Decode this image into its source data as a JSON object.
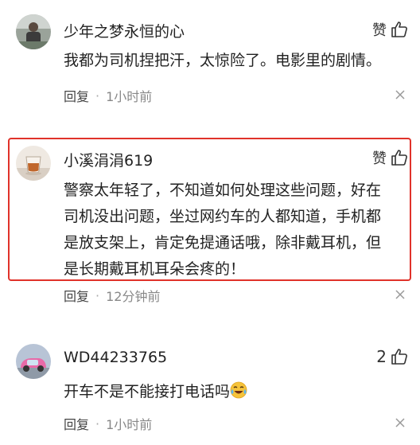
{
  "comments": [
    {
      "username": "少年之梦永恒的心",
      "like_label": "赞",
      "text": "我都为司机捏把汗，太惊险了。电影里的剧情。",
      "reply_label": "回复",
      "separator": "·",
      "time": "1小时前"
    },
    {
      "username": "小溪涓涓619",
      "like_label": "赞",
      "text_lines": [
        "警察太年轻了，不知道如何处理这些问题，好在",
        "司机没出问题，坐过网约车的人都知道，手机都",
        "是放支架上，肯定免提通话哦，除非戴耳机，但",
        "是长期戴耳机耳朵会疼的！"
      ],
      "reply_label": "回复",
      "separator": "·",
      "time": "12分钟前"
    },
    {
      "username": "WD44233765",
      "like_count": "2",
      "text": "开车不是不能接打电话吗",
      "emoji": "crying-laughing-emoji",
      "reply_label": "回复",
      "separator": "·",
      "time": "1小时前"
    }
  ],
  "colors": {
    "highlight_border": "#e0322a",
    "meta_text": "#888888"
  }
}
